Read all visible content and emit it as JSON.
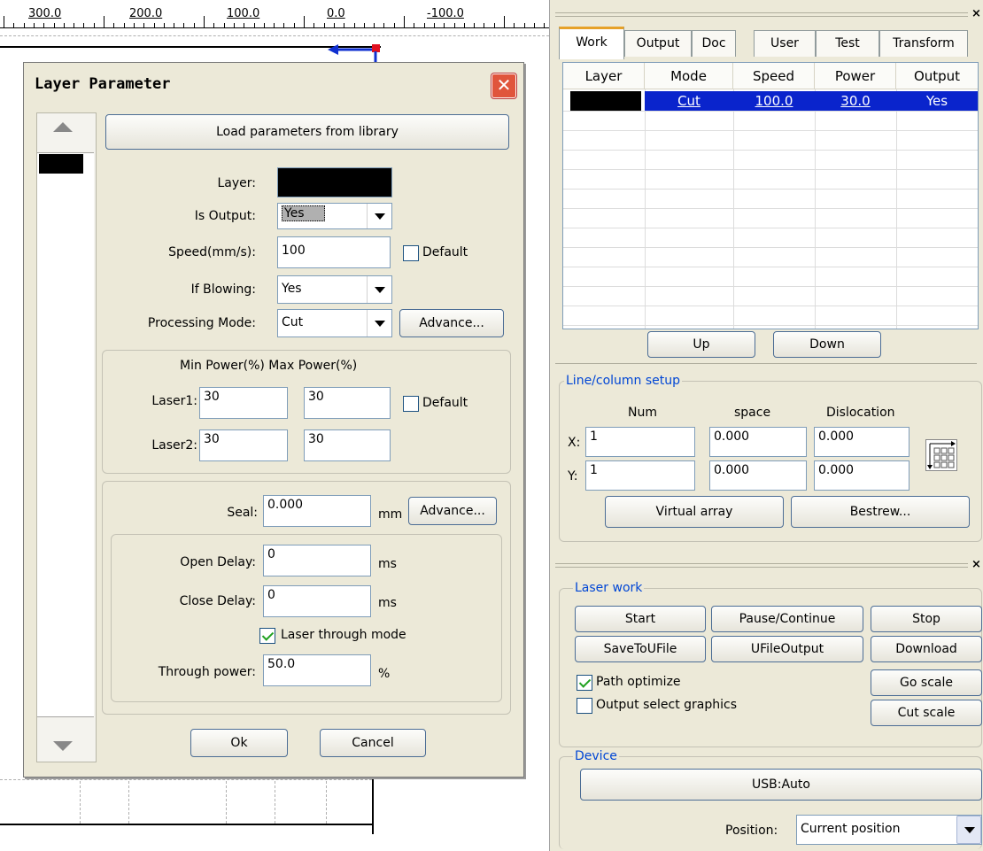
{
  "ruler": {
    "labels": [
      "300.0",
      "200.0",
      "100.0",
      "0.0",
      "-100.0"
    ]
  },
  "dialog": {
    "title": "Layer Parameter",
    "load_button": "Load parameters from library",
    "layer_label": "Layer:",
    "layer_color": "#000000",
    "is_output_label": "Is Output:",
    "is_output_value": "Yes",
    "speed_label": "Speed(mm/s):",
    "speed_value": "100",
    "default_label": "Default",
    "blowing_label": "If Blowing:",
    "blowing_value": "Yes",
    "mode_label": "Processing Mode:",
    "mode_value": "Cut",
    "advance_label": "Advance...",
    "power_header": "Min Power(%) Max Power(%)",
    "laser1_label": "Laser1:",
    "laser1_min": "30",
    "laser1_max": "30",
    "laser2_label": "Laser2:",
    "laser2_min": "30",
    "laser2_max": "30",
    "seal_label": "Seal:",
    "seal_value": "0.000",
    "mm_unit": "mm",
    "open_delay_label": "Open Delay:",
    "open_delay_value": "0",
    "close_delay_label": "Close Delay:",
    "close_delay_value": "0",
    "ms_unit": "ms",
    "through_mode_label": "Laser through mode",
    "through_power_label": "Through power:",
    "through_power_value": "50.0",
    "percent_unit": "%",
    "ok_label": "Ok",
    "cancel_label": "Cancel"
  },
  "panel": {
    "tabs": [
      "Work",
      "Output",
      "Doc",
      "User",
      "Test",
      "Transform"
    ],
    "table": {
      "headers": [
        "Layer",
        "Mode",
        "Speed",
        "Power",
        "Output"
      ],
      "rows": [
        {
          "color": "#000000",
          "mode": "Cut",
          "speed": "100.0",
          "power": "30.0",
          "output": "Yes"
        }
      ],
      "selection_color": "#0a24cc"
    },
    "up_label": "Up",
    "down_label": "Down",
    "line_setup": {
      "title": "Line/column setup",
      "num_header": "Num",
      "space_header": "space",
      "dislocation_header": "Dislocation",
      "x_label": "X:",
      "y_label": "Y:",
      "x_num": "1",
      "x_space": "0.000",
      "x_disloc": "0.000",
      "y_num": "1",
      "y_space": "0.000",
      "y_disloc": "0.000",
      "virtual_array_label": "Virtual array",
      "bestrew_label": "Bestrew..."
    },
    "laser_work": {
      "title": "Laser work",
      "start": "Start",
      "pause": "Pause/Continue",
      "stop": "Stop",
      "save": "SaveToUFile",
      "ufile": "UFileOutput",
      "download": "Download",
      "path_optimize": "Path optimize",
      "output_select": "Output select graphics",
      "go_scale": "Go scale",
      "cut_scale": "Cut scale"
    },
    "device": {
      "title": "Device",
      "usb_label": "USB:Auto",
      "position_label": "Position:",
      "position_value": "Current position"
    },
    "close_glyph": "×"
  }
}
